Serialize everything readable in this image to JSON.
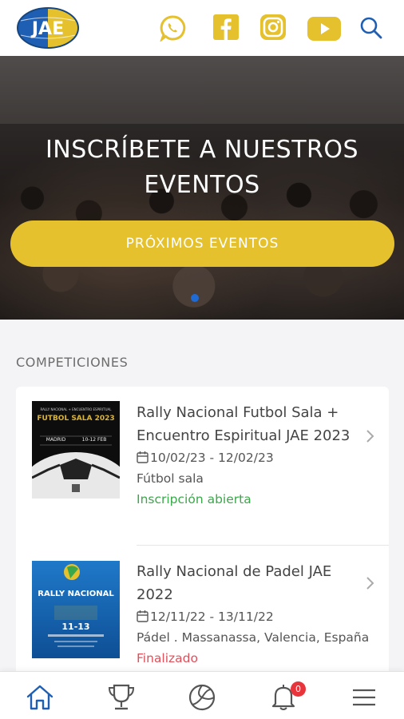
{
  "header": {
    "logo_text": "JAE",
    "icons": [
      "whatsapp-icon",
      "facebook-icon",
      "instagram-icon",
      "youtube-icon",
      "search-icon"
    ],
    "brand_yellow": "#e5c12e",
    "brand_blue": "#1e5fb3"
  },
  "hero": {
    "title": "INSCRÍBETE A NUESTROS EVENTOS",
    "button_label": "PRÓXIMOS EVENTOS",
    "carousel_active_index": 0
  },
  "competitions": {
    "section_title": "COMPETICIONES",
    "items": [
      {
        "title": "Rally Nacional Futbol Sala + Encuentro Espiritual JAE 2023",
        "dates": "10/02/23 - 12/02/23",
        "category": "Fútbol sala",
        "status": "Inscripción abierta",
        "poster": {
          "small_text": "RALLY NACIONAL + ENCUENTRO ESPIRITUAL",
          "headline": "FUTBOL SALA 2023",
          "place": "MADRID",
          "dates": "10-12 FEB"
        }
      },
      {
        "title": "Rally Nacional de Padel JAE 2022",
        "dates": "12/11/22 - 13/11/22",
        "category": "Pádel . Massanassa, Valencia, España",
        "status": "Finalizado",
        "poster": {
          "headline": "RALLY NACIONAL",
          "dates": "11-13"
        }
      }
    ]
  },
  "bottom_nav": {
    "items": [
      "home-icon",
      "trophy-icon",
      "volleyball-icon",
      "bell-icon",
      "menu-icon"
    ],
    "active": "home-icon",
    "notification_count": "0"
  }
}
